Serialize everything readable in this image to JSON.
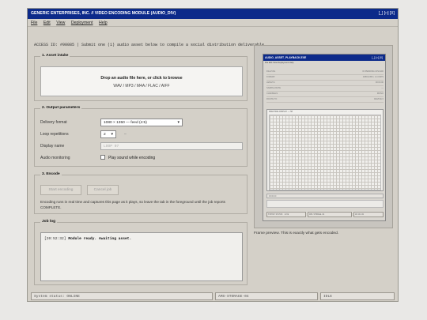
{
  "window": {
    "title": "GENERIC ENTERPRISES, INC. // VIDEO ENCODING MODULE (AUDIO_DIV)",
    "controls": "[_] [□] [X]"
  },
  "menu": [
    "File",
    "Edit",
    "View",
    "Deployment",
    "Help"
  ],
  "access_line": "ACCESS ID: #90085  |  Submit one (1) audio asset below to compile a social distribution deliverable.",
  "asset_intake": {
    "legend": "1. Asset intake",
    "drop_title": "Drop an audio file here, or click to browse",
    "drop_formats": "WAV / MP3 / M4A / FLAC / AIFF"
  },
  "output_params": {
    "legend": "2. Output parameters",
    "delivery_label": "Delivery format",
    "delivery_value": "1080 × 1350 — feed (4:5)",
    "loop_label": "Loop repetitions",
    "loop_value": "2",
    "loop_hint": "–",
    "display_label": "Display name",
    "display_placeholder": "LOOP 07",
    "monitor_label": "Audio monitoring",
    "monitor_checkbox_label": "Play sound while encoding"
  },
  "encode": {
    "legend": "3. Encode",
    "start_label": "Start encoding",
    "cancel_label": "Cancel job",
    "note": "Encoding runs in real time and captures this page as it plays, so leave the tab in the foreground until the job reports COMPLETE."
  },
  "job_log": {
    "legend": "Job log",
    "timestamp": "[20:52:32]",
    "message": "Module ready. Awaiting asset."
  },
  "status_bar": {
    "system": "System status: ONLINE",
    "storage": "AMS-STORAGE-04",
    "state": "IDLE"
  },
  "preview": {
    "mini_title": "AUDIO_ASSET_PLAYBACK.EXE",
    "mini_controls": "[_] [□] [X]",
    "mini_menu": "File  Edit  View  Deployment  Help",
    "mini_rows": [
      {
        "label": "FILE TAG",
        "value": "ID PENDING UPLOAD"
      },
      {
        "label": "FORMAT",
        "value": "1080x1350 • 2 LOOPS"
      },
      {
        "label": "LENGTH",
        "value": "00:00.00"
      },
      {
        "label": "SAMPLE RATE",
        "value": "—"
      },
      {
        "label": "CHANNELS",
        "value": "MONO"
      },
      {
        "label": "ROUTE TO",
        "value": "DEVICE 0"
      }
    ],
    "mini_screen_header": "SPECTRAL DISPLAY — HZ",
    "mini_bar": "00:00.00",
    "mini_status": [
      "SYSTEM STATUS: LIVE",
      "AMS-STORAGE-04",
      "00:00.00"
    ],
    "caption": "Frame preview. This is exactly what gets encoded."
  }
}
